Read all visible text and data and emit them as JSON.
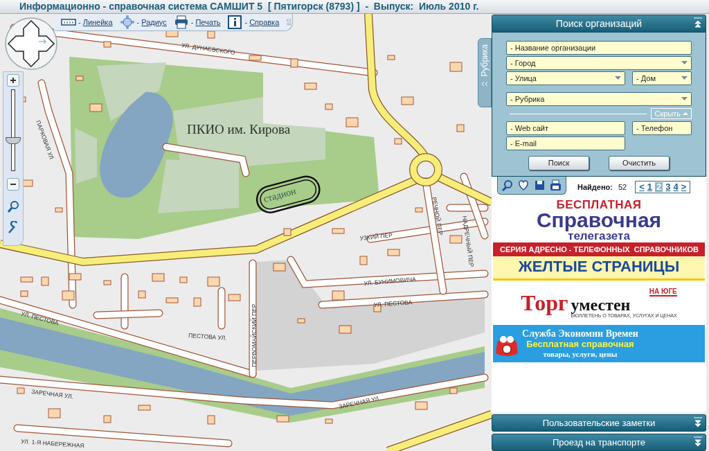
{
  "window": {
    "title": "Информационно - справочная система САМШИТ 5  [ Пятигорск (8793) ]  -  Выпуск:  Июль 2010 г."
  },
  "toolbar": {
    "items": [
      {
        "kind": "ruler",
        "dash": "-",
        "label": "Линейка"
      },
      {
        "kind": "radius",
        "dash": "-",
        "label": "Радиус"
      },
      {
        "kind": "print",
        "dash": "-",
        "label": "Печать"
      },
      {
        "kind": "help",
        "dash": "-",
        "label": "Справка"
      }
    ]
  },
  "zoom": {
    "level": 0.35
  },
  "map": {
    "labels": [
      {
        "kind": "park",
        "text": "ПКИО им. Кирова"
      },
      {
        "kind": "stadium",
        "text": "стадион"
      },
      {
        "kind": "street",
        "text": "УЛ. ДУНАЕВСКОГО"
      },
      {
        "kind": "street",
        "text": "ПАРКОВАЯ УЛ"
      },
      {
        "kind": "street",
        "text": "УЛ. ПЕСТОВА"
      },
      {
        "kind": "street",
        "text": "ПЕСТОВА УЛ."
      },
      {
        "kind": "street",
        "text": "ПЕРВОМАЙСКИЙ ПЕР"
      },
      {
        "kind": "street",
        "text": "УЛ. БУНИМОВИЧА"
      },
      {
        "kind": "street",
        "text": "УЛ. ПЕСТОВА"
      },
      {
        "kind": "street",
        "text": "ЗАРЕЧНАЯ УЛ."
      },
      {
        "kind": "street",
        "text": "ЗАРЕЧНАЯ УЛ."
      },
      {
        "kind": "street",
        "text": "УЛ. 1-Я НАБЕРЕЖНАЯ"
      },
      {
        "kind": "street",
        "text": "УЗКИЙ ПЕР"
      },
      {
        "kind": "street",
        "text": "РЕЧНОЙ ПЕР"
      },
      {
        "kind": "street",
        "text": "НАДРЕЧНЫЙ ПЕР"
      }
    ]
  },
  "side_tab": {
    "label": "Рубрика"
  },
  "search_panel": {
    "title": "Поиск организаций",
    "main_rows": [
      [
        {
          "kind": "text",
          "placeholder": "- Название организации"
        }
      ],
      [
        {
          "kind": "select",
          "placeholder": "- Город"
        }
      ],
      [
        {
          "kind": "select",
          "placeholder": "- Улица"
        },
        {
          "kind": "select",
          "placeholder": "- Дом"
        }
      ],
      [
        {
          "kind": "select",
          "placeholder": "- Рубрика"
        }
      ]
    ],
    "hide_button": "Скрыть",
    "extra_rows": [
      [
        {
          "kind": "text",
          "placeholder": "- Web сайт"
        },
        {
          "kind": "text",
          "placeholder": "- Телефон"
        }
      ],
      [
        {
          "kind": "text",
          "placeholder": "- E-mail"
        }
      ]
    ],
    "buttons": [
      "Поиск",
      "Очистить"
    ]
  },
  "results": {
    "found_label": "Найдено:",
    "found_count": "52",
    "prev": "<",
    "next": ">",
    "pages": [
      {
        "label": "1",
        "selected": false
      },
      {
        "label": "2",
        "selected": true
      },
      {
        "label": "3",
        "selected": false
      },
      {
        "label": "4",
        "selected": false
      }
    ]
  },
  "banners": [
    {
      "kind": "telegazeta",
      "texts": [
        "БЕСПЛАТНАЯ",
        "Справочная",
        "телегазета"
      ]
    },
    {
      "kind": "yellow_pages",
      "texts": [
        "СЕРИЯ АДРЕСНО - ТЕЛЕФОННЫХ  СПРАВОЧНИКОВ",
        "ЖЕЛТЫЕ СТРАНИЦЫ"
      ]
    },
    {
      "kind": "torg",
      "texts": [
        "Торг",
        "НА ЮГЕ",
        "уместен",
        "БЮЛЛЕТЕНЬ О ТОВАРАХ, УСЛУГАХ И ЦЕНАХ"
      ]
    },
    {
      "kind": "sev",
      "texts": [
        "**С**лужба **Э**кономии **В**ремен",
        "Бесплатная справочная",
        "товары, услуги, цены"
      ]
    }
  ],
  "bottom_panels": [
    {
      "title": "Пользовательские заметки"
    },
    {
      "title": "Проезд на транспорте"
    }
  ]
}
